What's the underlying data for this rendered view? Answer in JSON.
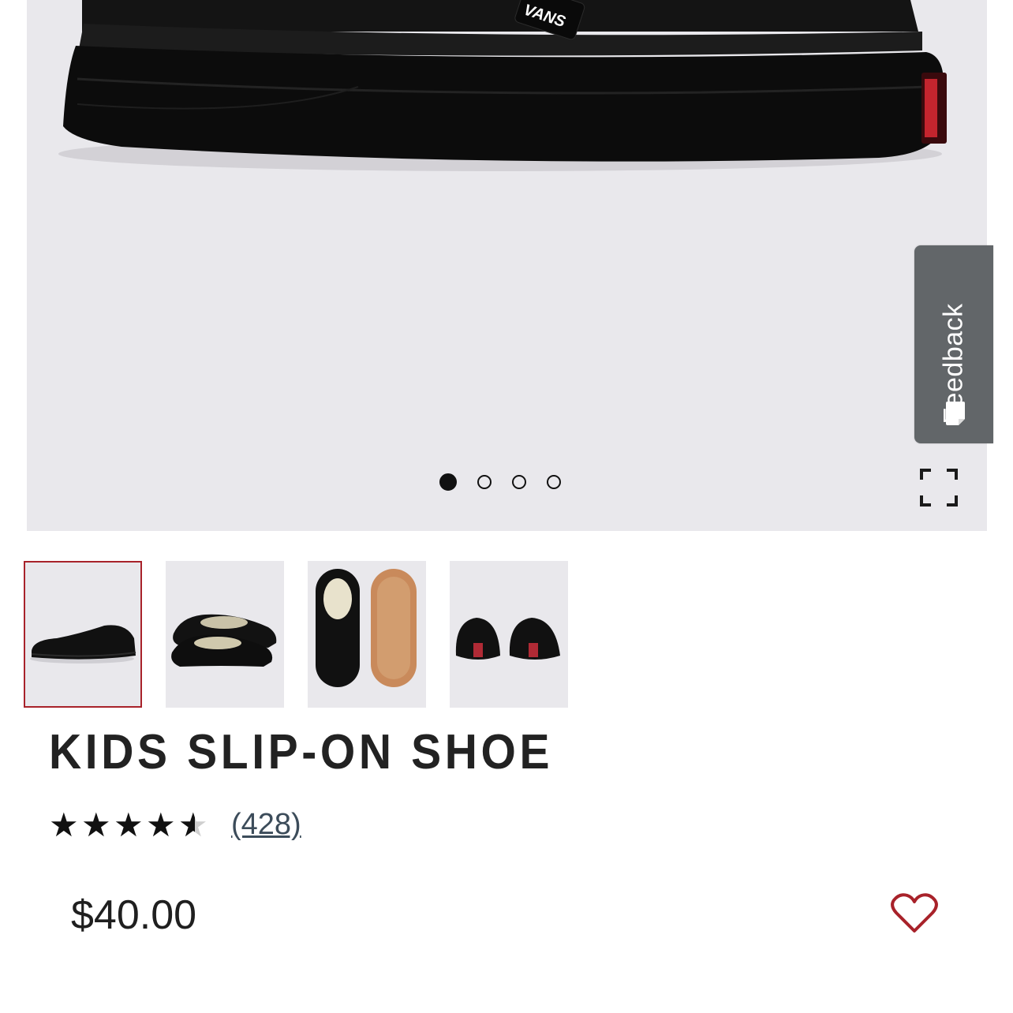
{
  "feedback": {
    "label": "Feedback"
  },
  "gallery": {
    "slide_count": 4,
    "active_slide": 1,
    "thumbnails": [
      {
        "view": "side",
        "selected": true
      },
      {
        "view": "pair-angle",
        "selected": false
      },
      {
        "view": "top-and-sole",
        "selected": false
      },
      {
        "view": "heels",
        "selected": false
      }
    ],
    "logo_text": "VANS"
  },
  "product": {
    "title": "KIDS SLIP-ON SHOE",
    "rating": 4.5,
    "rating_max": 5,
    "review_count": "(428)",
    "price": "$40.00"
  },
  "icons": {
    "expand": "fullscreen-expand-icon",
    "wishlist": "heart-outline-icon",
    "feedback": "feedback-note-icon",
    "star": "star-icon"
  },
  "colors": {
    "accent": "#a8222a",
    "feedback_bg": "#626669",
    "hero_bg": "#e9e8ec",
    "link": "#3c4c5a"
  }
}
